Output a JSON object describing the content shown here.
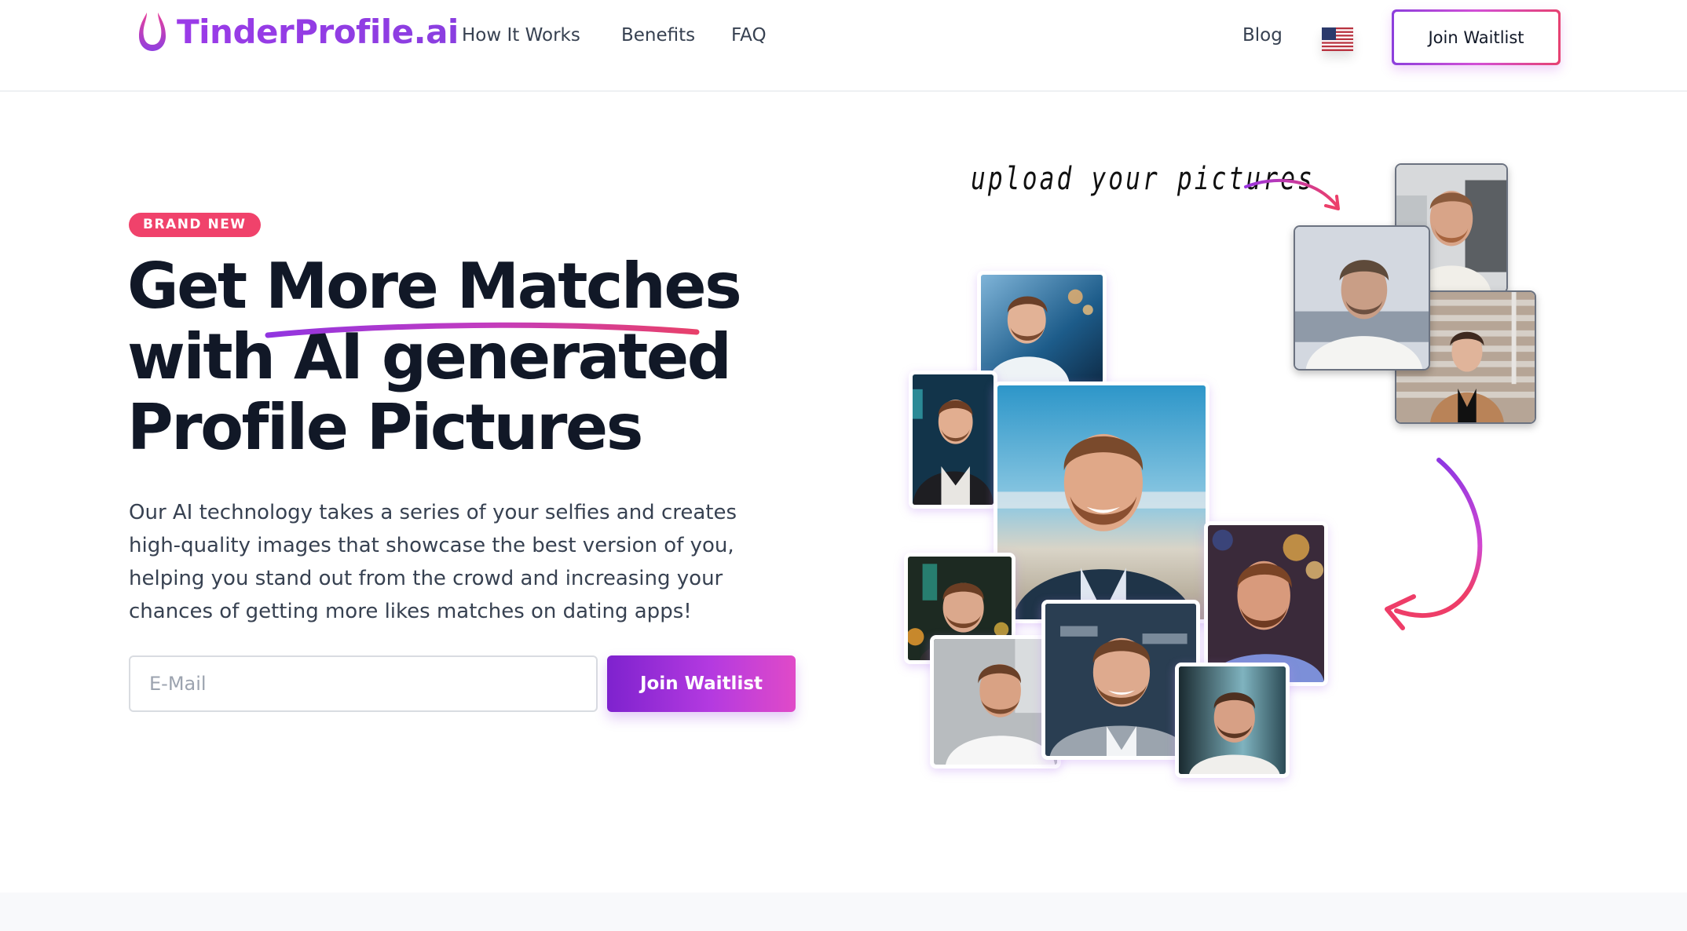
{
  "header": {
    "logo_text": "TinderProfile.ai",
    "nav": [
      "How It Works",
      "Benefits",
      "FAQ"
    ],
    "blog_label": "Blog",
    "language_flag": "us-flag",
    "cta_label": "Join Waitlist"
  },
  "hero": {
    "badge": "BRAND NEW",
    "headline": [
      "Get More Matches",
      "with AI generated",
      "Profile Pictures"
    ],
    "highlighted_phrase": "More Matches",
    "description": "Our AI technology takes a series of your selfies and creates high-quality images that showcase the best version of you, helping you stand out from the crowd and increasing your chances of getting more likes matches on dating apps!",
    "email_placeholder": "E-Mail",
    "email_value": "",
    "cta_label": "Join Waitlist"
  },
  "collage": {
    "upload_label": "upload your pictures",
    "uploaded_photos": [
      "selfie-office",
      "selfie-sea",
      "selfie-stairs"
    ],
    "generated_photos": [
      "street-sunset",
      "night-jacket",
      "blue-sky-jacket",
      "bokeh-warm",
      "night-city",
      "street-white-shirt",
      "office-blazer",
      "studio-teal"
    ]
  },
  "colors": {
    "brand_purple": "#8a3ee0",
    "brand_pink": "#f0426b",
    "text_dark": "#111827",
    "text_body": "#374151"
  }
}
